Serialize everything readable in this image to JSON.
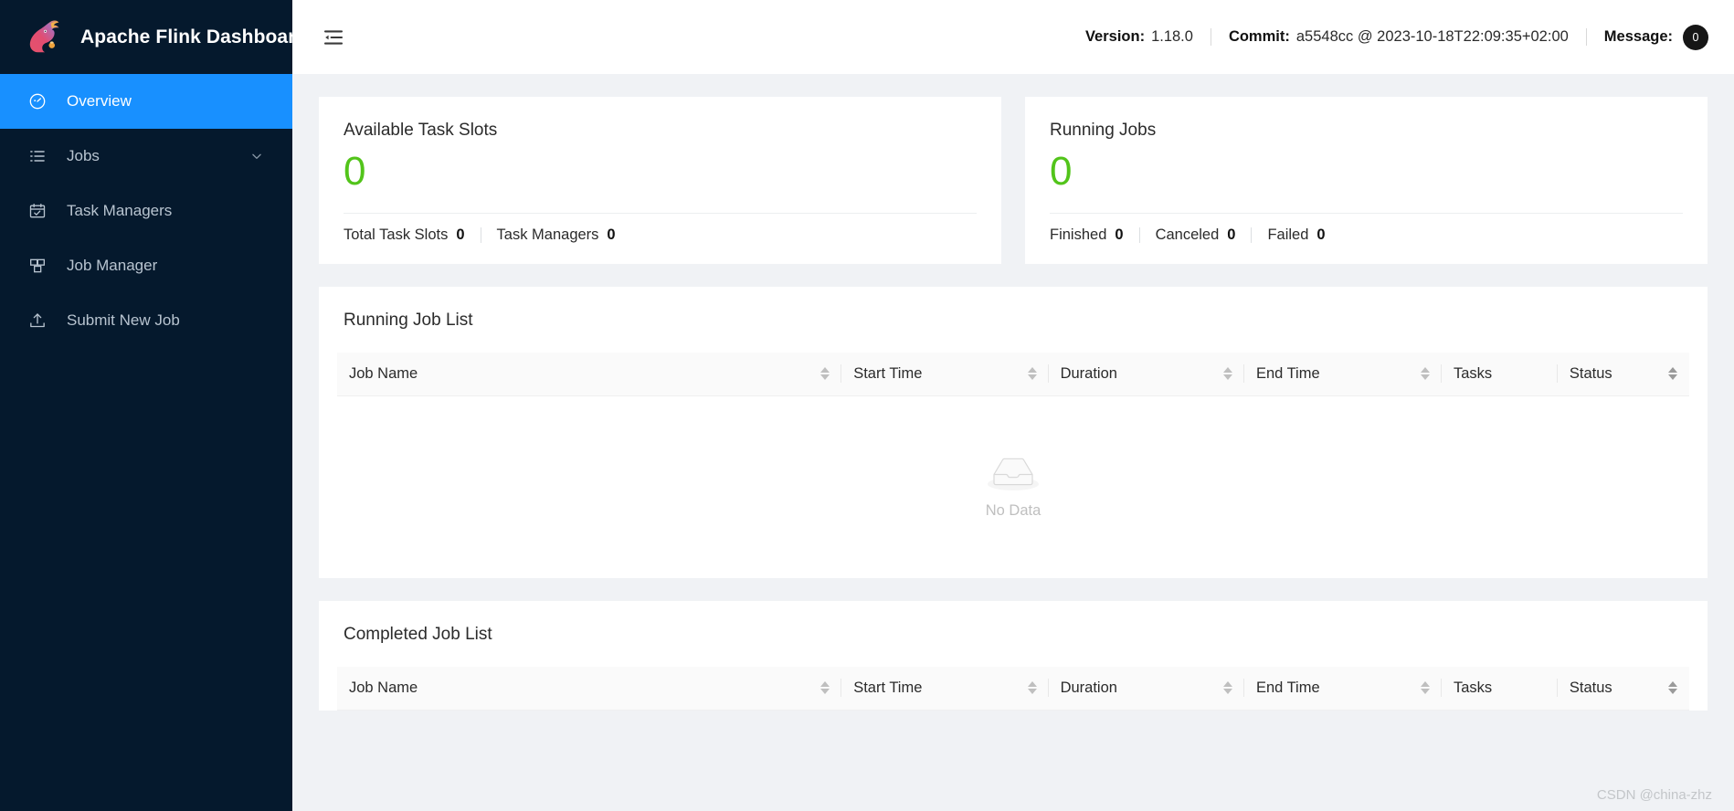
{
  "brand": {
    "title": "Apache Flink Dashboard",
    "logo_icon": "flink-squirrel-logo"
  },
  "sidebar": {
    "items": [
      {
        "label": "Overview",
        "icon": "dashboard-icon",
        "active": true,
        "has_chevron": false
      },
      {
        "label": "Jobs",
        "icon": "list-icon",
        "active": false,
        "has_chevron": true
      },
      {
        "label": "Task Managers",
        "icon": "schedule-check-icon",
        "active": false,
        "has_chevron": false
      },
      {
        "label": "Job Manager",
        "icon": "blocks-icon",
        "active": false,
        "has_chevron": false
      },
      {
        "label": "Submit New Job",
        "icon": "upload-icon",
        "active": false,
        "has_chevron": false
      }
    ]
  },
  "topbar": {
    "fold_icon": "menu-fold-icon",
    "version_key": "Version:",
    "version_value": "1.18.0",
    "commit_key": "Commit:",
    "commit_value": "a5548cc @ 2023-10-18T22:09:35+02:00",
    "message_key": "Message:",
    "message_count": "0"
  },
  "cards": [
    {
      "title": "Available Task Slots",
      "value": "0",
      "stats": [
        {
          "label": "Total Task Slots",
          "value": "0"
        },
        {
          "label": "Task Managers",
          "value": "0"
        }
      ]
    },
    {
      "title": "Running Jobs",
      "value": "0",
      "stats": [
        {
          "label": "Finished",
          "value": "0"
        },
        {
          "label": "Canceled",
          "value": "0"
        },
        {
          "label": "Failed",
          "value": "0"
        }
      ]
    }
  ],
  "running_job_list": {
    "title": "Running Job List",
    "columns": [
      {
        "label": "Job Name",
        "sortable": true,
        "active_sort": false
      },
      {
        "label": "Start Time",
        "sortable": true,
        "active_sort": false
      },
      {
        "label": "Duration",
        "sortable": true,
        "active_sort": false
      },
      {
        "label": "End Time",
        "sortable": true,
        "active_sort": false
      },
      {
        "label": "Tasks",
        "sortable": false,
        "active_sort": false
      },
      {
        "label": "Status",
        "sortable": true,
        "active_sort": true
      }
    ],
    "rows": [],
    "empty_label": "No Data",
    "empty_icon": "empty-inbox-icon"
  },
  "completed_job_list": {
    "title": "Completed Job List",
    "columns": [
      {
        "label": "Job Name",
        "sortable": true,
        "active_sort": false
      },
      {
        "label": "Start Time",
        "sortable": true,
        "active_sort": false
      },
      {
        "label": "Duration",
        "sortable": true,
        "active_sort": false
      },
      {
        "label": "End Time",
        "sortable": true,
        "active_sort": false
      },
      {
        "label": "Tasks",
        "sortable": false,
        "active_sort": false
      },
      {
        "label": "Status",
        "sortable": true,
        "active_sort": true
      }
    ],
    "rows": []
  },
  "watermark": "CSDN @china-zhz",
  "colors": {
    "sidebar_bg": "#05192d",
    "accent_blue": "#1890ff",
    "value_green": "#52c41a",
    "page_bg": "#f0f2f5"
  }
}
